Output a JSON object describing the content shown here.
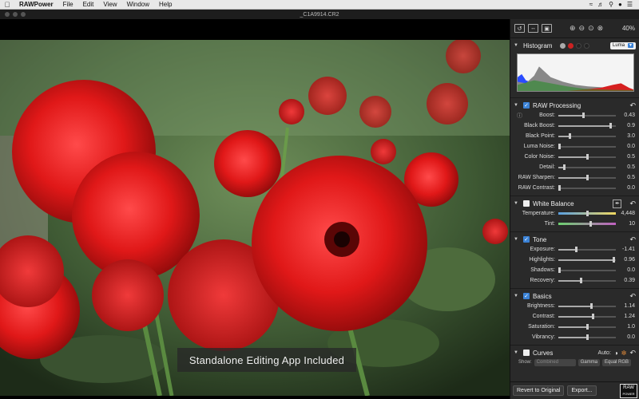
{
  "menubar": {
    "apple_icon": "apple-icon",
    "items": [
      "RAWPower",
      "File",
      "Edit",
      "View",
      "Window",
      "Help"
    ]
  },
  "window": {
    "title": "_C1A9914.CR2"
  },
  "viewer": {
    "caption": "Standalone Editing App Included"
  },
  "toolbar": {
    "zoom_percent": "40%"
  },
  "histogram": {
    "label": "Histogram",
    "channel": "Luma",
    "dot_colors": [
      "#aaaaaa",
      "#cc2222",
      "#222222",
      "#222222"
    ]
  },
  "raw": {
    "label": "RAW Processing",
    "sliders": [
      {
        "label": "Boost:",
        "value": "0.43",
        "fill": 0.43
      },
      {
        "label": "Black Boost:",
        "value": "0.9",
        "fill": 0.9
      },
      {
        "label": "Black Point:",
        "value": "3.0",
        "fill": 0.2
      },
      {
        "label": "Luma Noise:",
        "value": "0.0",
        "fill": 0.0
      },
      {
        "label": "Color Noise:",
        "value": "0.5",
        "fill": 0.5
      },
      {
        "label": "Detail:",
        "value": "0.5",
        "fill": 0.1
      },
      {
        "label": "RAW Sharpen:",
        "value": "0.5",
        "fill": 0.5
      },
      {
        "label": "RAW Contrast:",
        "value": "0.0",
        "fill": 0.0
      }
    ]
  },
  "white_balance": {
    "label": "White Balance",
    "sliders": [
      {
        "label": "Temperature:",
        "value": "4,448",
        "fill": 0.5
      },
      {
        "label": "Tint:",
        "value": "10",
        "fill": 0.55
      }
    ]
  },
  "tone": {
    "label": "Tone",
    "sliders": [
      {
        "label": "Exposure:",
        "value": "-1.41",
        "fill": 0.3
      },
      {
        "label": "Highlights:",
        "value": "0.96",
        "fill": 0.96
      },
      {
        "label": "Shadows:",
        "value": "0.0",
        "fill": 0.0
      },
      {
        "label": "Recovery:",
        "value": "0.39",
        "fill": 0.39
      }
    ]
  },
  "basics": {
    "label": "Basics",
    "sliders": [
      {
        "label": "Brightness:",
        "value": "1.14",
        "fill": 0.57
      },
      {
        "label": "Contrast:",
        "value": "1.24",
        "fill": 0.6
      },
      {
        "label": "Saturation:",
        "value": "1.0",
        "fill": 0.5
      },
      {
        "label": "Vibrancy:",
        "value": "0.0",
        "fill": 0.5
      }
    ]
  },
  "curves": {
    "label": "Curves",
    "auto_label": "Auto:",
    "show_label": "Show:",
    "show_value": "Combined",
    "gamma_label": "Gamma",
    "equal_rgb_label": "Equal RGB"
  },
  "actions": {
    "revert": "Revert to Original",
    "export": "Export...",
    "logo_line1": "RAW",
    "logo_line2": "POWER"
  }
}
